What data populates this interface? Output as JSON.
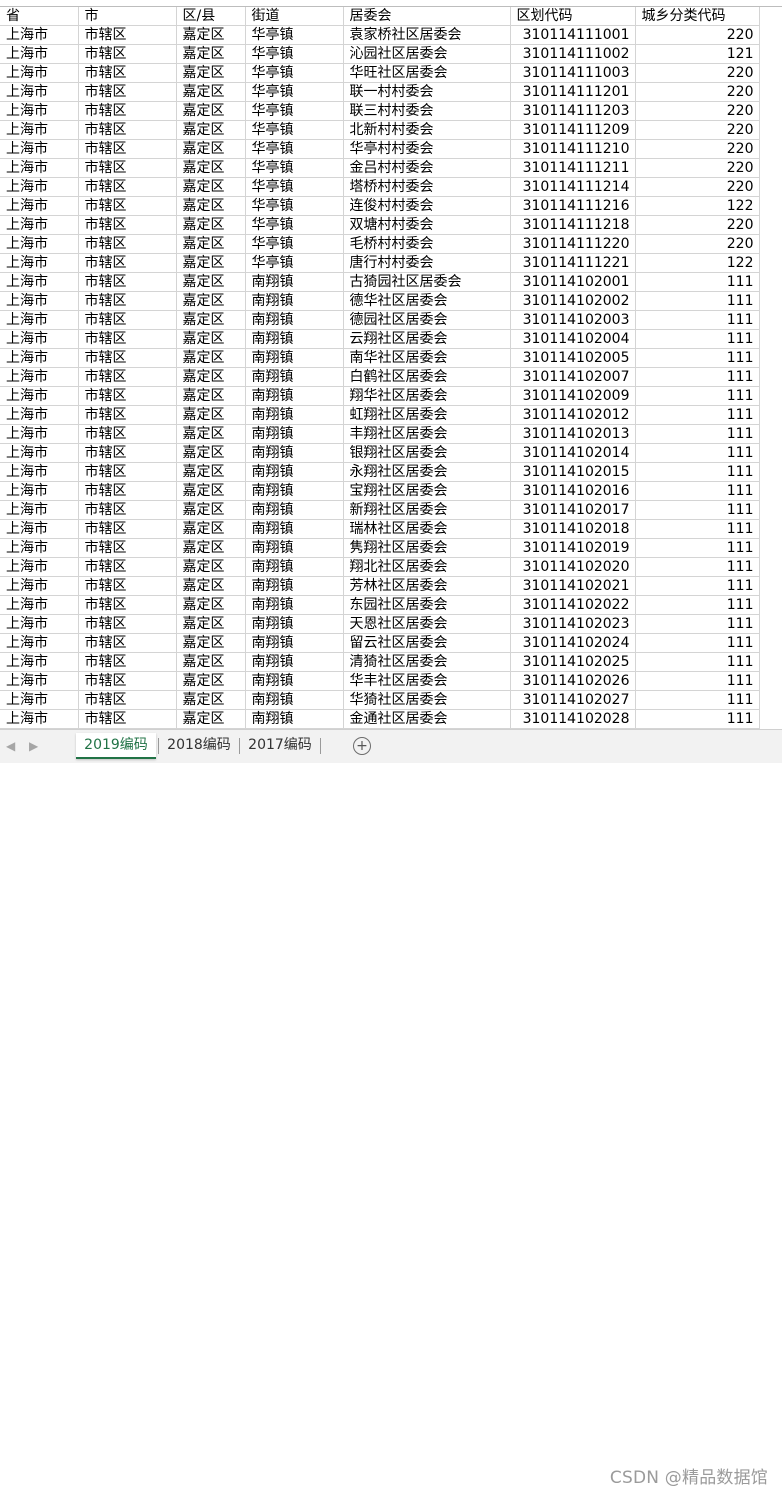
{
  "headers": [
    "省",
    "市",
    "区/县",
    "街道",
    "居委会",
    "区划代码",
    "城乡分类代码"
  ],
  "rows": [
    [
      "上海市",
      "市辖区",
      "嘉定区",
      "华亭镇",
      "袁家桥社区居委会",
      "310114111001",
      "220"
    ],
    [
      "上海市",
      "市辖区",
      "嘉定区",
      "华亭镇",
      "沁园社区居委会",
      "310114111002",
      "121"
    ],
    [
      "上海市",
      "市辖区",
      "嘉定区",
      "华亭镇",
      "华旺社区居委会",
      "310114111003",
      "220"
    ],
    [
      "上海市",
      "市辖区",
      "嘉定区",
      "华亭镇",
      "联一村村委会",
      "310114111201",
      "220"
    ],
    [
      "上海市",
      "市辖区",
      "嘉定区",
      "华亭镇",
      "联三村村委会",
      "310114111203",
      "220"
    ],
    [
      "上海市",
      "市辖区",
      "嘉定区",
      "华亭镇",
      "北新村村委会",
      "310114111209",
      "220"
    ],
    [
      "上海市",
      "市辖区",
      "嘉定区",
      "华亭镇",
      "华亭村村委会",
      "310114111210",
      "220"
    ],
    [
      "上海市",
      "市辖区",
      "嘉定区",
      "华亭镇",
      "金吕村村委会",
      "310114111211",
      "220"
    ],
    [
      "上海市",
      "市辖区",
      "嘉定区",
      "华亭镇",
      "塔桥村村委会",
      "310114111214",
      "220"
    ],
    [
      "上海市",
      "市辖区",
      "嘉定区",
      "华亭镇",
      "连俊村村委会",
      "310114111216",
      "122"
    ],
    [
      "上海市",
      "市辖区",
      "嘉定区",
      "华亭镇",
      "双塘村村委会",
      "310114111218",
      "220"
    ],
    [
      "上海市",
      "市辖区",
      "嘉定区",
      "华亭镇",
      "毛桥村村委会",
      "310114111220",
      "220"
    ],
    [
      "上海市",
      "市辖区",
      "嘉定区",
      "华亭镇",
      "唐行村村委会",
      "310114111221",
      "122"
    ],
    [
      "上海市",
      "市辖区",
      "嘉定区",
      "南翔镇",
      "古猗园社区居委会",
      "310114102001",
      "111"
    ],
    [
      "上海市",
      "市辖区",
      "嘉定区",
      "南翔镇",
      "德华社区居委会",
      "310114102002",
      "111"
    ],
    [
      "上海市",
      "市辖区",
      "嘉定区",
      "南翔镇",
      "德园社区居委会",
      "310114102003",
      "111"
    ],
    [
      "上海市",
      "市辖区",
      "嘉定区",
      "南翔镇",
      "云翔社区居委会",
      "310114102004",
      "111"
    ],
    [
      "上海市",
      "市辖区",
      "嘉定区",
      "南翔镇",
      "南华社区居委会",
      "310114102005",
      "111"
    ],
    [
      "上海市",
      "市辖区",
      "嘉定区",
      "南翔镇",
      "白鹤社区居委会",
      "310114102007",
      "111"
    ],
    [
      "上海市",
      "市辖区",
      "嘉定区",
      "南翔镇",
      "翔华社区居委会",
      "310114102009",
      "111"
    ],
    [
      "上海市",
      "市辖区",
      "嘉定区",
      "南翔镇",
      "虹翔社区居委会",
      "310114102012",
      "111"
    ],
    [
      "上海市",
      "市辖区",
      "嘉定区",
      "南翔镇",
      "丰翔社区居委会",
      "310114102013",
      "111"
    ],
    [
      "上海市",
      "市辖区",
      "嘉定区",
      "南翔镇",
      "银翔社区居委会",
      "310114102014",
      "111"
    ],
    [
      "上海市",
      "市辖区",
      "嘉定区",
      "南翔镇",
      "永翔社区居委会",
      "310114102015",
      "111"
    ],
    [
      "上海市",
      "市辖区",
      "嘉定区",
      "南翔镇",
      "宝翔社区居委会",
      "310114102016",
      "111"
    ],
    [
      "上海市",
      "市辖区",
      "嘉定区",
      "南翔镇",
      "新翔社区居委会",
      "310114102017",
      "111"
    ],
    [
      "上海市",
      "市辖区",
      "嘉定区",
      "南翔镇",
      "瑞林社区居委会",
      "310114102018",
      "111"
    ],
    [
      "上海市",
      "市辖区",
      "嘉定区",
      "南翔镇",
      "隽翔社区居委会",
      "310114102019",
      "111"
    ],
    [
      "上海市",
      "市辖区",
      "嘉定区",
      "南翔镇",
      "翔北社区居委会",
      "310114102020",
      "111"
    ],
    [
      "上海市",
      "市辖区",
      "嘉定区",
      "南翔镇",
      "芳林社区居委会",
      "310114102021",
      "111"
    ],
    [
      "上海市",
      "市辖区",
      "嘉定区",
      "南翔镇",
      "东园社区居委会",
      "310114102022",
      "111"
    ],
    [
      "上海市",
      "市辖区",
      "嘉定区",
      "南翔镇",
      "天恩社区居委会",
      "310114102023",
      "111"
    ],
    [
      "上海市",
      "市辖区",
      "嘉定区",
      "南翔镇",
      "留云社区居委会",
      "310114102024",
      "111"
    ],
    [
      "上海市",
      "市辖区",
      "嘉定区",
      "南翔镇",
      "清猗社区居委会",
      "310114102025",
      "111"
    ],
    [
      "上海市",
      "市辖区",
      "嘉定区",
      "南翔镇",
      "华丰社区居委会",
      "310114102026",
      "111"
    ],
    [
      "上海市",
      "市辖区",
      "嘉定区",
      "南翔镇",
      "华猗社区居委会",
      "310114102027",
      "111"
    ],
    [
      "上海市",
      "市辖区",
      "嘉定区",
      "南翔镇",
      "金通社区居委会",
      "310114102028",
      "111"
    ]
  ],
  "tabs": [
    {
      "label": "2019编码",
      "active": true
    },
    {
      "label": "2018编码",
      "active": false
    },
    {
      "label": "2017编码",
      "active": false
    }
  ],
  "add_sheet_symbol": "+",
  "nav_prev": "◀",
  "nav_next": "▶",
  "watermark": "CSDN @精品数据馆",
  "colors": {
    "active_tab": "#217346",
    "grid_line": "#d4d4d4",
    "tab_bar": "#f2f2f2"
  }
}
